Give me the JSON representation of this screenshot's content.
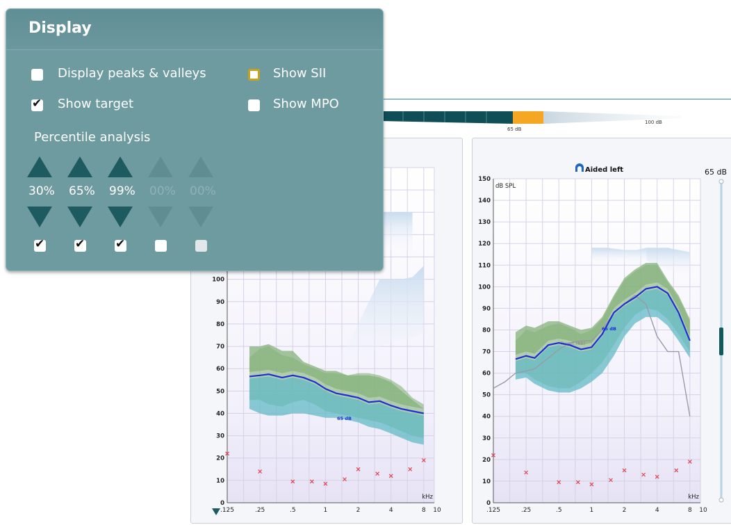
{
  "display_panel": {
    "title": "Display",
    "options": {
      "peaks_valleys": {
        "label": "Display peaks & valleys",
        "checked": false
      },
      "show_sii": {
        "label": "Show SII",
        "checked": false
      },
      "show_target": {
        "label": "Show target",
        "checked": true
      },
      "show_mpo": {
        "label": "Show MPO",
        "checked": false
      }
    },
    "percentile": {
      "label": "Percentile analysis",
      "values": [
        "30%",
        "65%",
        "99%",
        "00%",
        "00%"
      ],
      "checked": [
        true,
        true,
        true,
        false,
        false
      ]
    }
  },
  "level_bar": {
    "marker_65": "65 dB",
    "marker_100": "100 dB"
  },
  "chart_common": {
    "unit": "dB SPL",
    "y_ticks": [
      "0",
      "10",
      "20",
      "30",
      "40",
      "50",
      "60",
      "70",
      "80",
      "90",
      "100",
      "110",
      "120",
      "130",
      "140",
      "150"
    ],
    "x_ticks": [
      ".125",
      ".25",
      ".5",
      "1",
      "2",
      "4",
      "8",
      "10"
    ],
    "x_unit": "kHz",
    "curve_label": "65 dB",
    "target_label": "Target (65)"
  },
  "right_chart": {
    "title": "Aided left",
    "level_readout": "65 dB"
  },
  "chart_data": [
    {
      "type": "line",
      "title": "",
      "ylabel": "dB SPL",
      "xlabel": "kHz",
      "ylim": [
        0,
        150
      ],
      "x_scale": "log",
      "series": [
        {
          "name": "65 dB",
          "x": [
            0.2,
            0.25,
            0.3,
            0.4,
            0.5,
            0.63,
            0.8,
            1,
            1.25,
            1.6,
            2,
            2.5,
            3.15,
            4,
            5,
            6.3,
            8
          ],
          "y": [
            56.5,
            57,
            57.5,
            56,
            57,
            56,
            54,
            51,
            49,
            48,
            47,
            45,
            45.5,
            43.5,
            42,
            41,
            40
          ]
        }
      ],
      "band_65_upper": [
        65,
        69,
        70,
        66,
        65,
        62,
        60,
        58,
        58,
        57,
        58,
        58,
        57,
        55,
        52,
        47,
        44
      ],
      "band_65_lower": [
        42,
        40,
        39,
        39,
        40,
        40,
        39,
        38,
        38,
        37,
        36,
        34,
        33,
        31,
        29,
        27,
        26
      ],
      "band_30_lower": [
        46,
        46,
        44,
        43,
        45,
        46,
        44,
        41,
        40,
        39,
        38,
        37,
        36,
        34,
        32,
        30,
        29
      ],
      "band_99_upper": [
        70,
        70,
        71,
        68,
        68,
        63,
        61,
        59,
        59,
        57,
        57,
        57,
        56,
        54,
        50,
        46,
        42
      ],
      "mpo_fragment": {
        "x": [
          1.0,
          1.6,
          2,
          3.15,
          4,
          5,
          6.3,
          8
        ],
        "y_upper": [
          60,
          70,
          80,
          100,
          100,
          100,
          101,
          106
        ],
        "y_lower": [
          53,
          58,
          62,
          70,
          72,
          73,
          74,
          76
        ]
      },
      "threshold_x": [
        0.125,
        0.25,
        0.5,
        0.75,
        1,
        1.5,
        2,
        3,
        4,
        6,
        8
      ],
      "threshold_y": [
        22,
        14,
        9.5,
        9.5,
        8.5,
        10.5,
        15,
        13,
        12,
        15,
        19
      ]
    },
    {
      "type": "line",
      "title": "Aided left",
      "ylabel": "dB SPL",
      "xlabel": "kHz",
      "ylim": [
        0,
        150
      ],
      "x_scale": "log",
      "series": [
        {
          "name": "65 dB",
          "x": [
            0.2,
            0.25,
            0.3,
            0.4,
            0.5,
            0.63,
            0.8,
            1,
            1.25,
            1.6,
            2,
            2.5,
            3.15,
            4,
            5,
            6.3,
            8
          ],
          "y": [
            66.5,
            68,
            67,
            73,
            74,
            73,
            71,
            72,
            78,
            88,
            92,
            95,
            99,
            100,
            97,
            88,
            75
          ]
        },
        {
          "name": "Target (65)",
          "x": [
            0.125,
            0.16,
            0.2,
            0.25,
            0.3,
            0.4,
            0.5,
            0.63,
            0.8,
            1,
            1.25,
            1.6,
            2,
            2.5,
            3.15,
            4,
            5,
            6.3,
            8
          ],
          "y": [
            53,
            56,
            60,
            61,
            62,
            67,
            71,
            74,
            75,
            75,
            80,
            88,
            92,
            96,
            92,
            77,
            70,
            70,
            40
          ]
        }
      ],
      "band_65_upper": [
        75,
        80,
        79,
        82,
        83,
        81,
        78,
        80,
        85,
        95,
        103,
        107,
        110,
        110,
        102,
        95,
        84
      ],
      "band_65_lower": [
        57,
        58,
        55,
        52,
        51,
        51,
        53,
        56,
        60,
        68,
        77,
        83,
        86,
        86,
        82,
        75,
        67
      ],
      "band_99_upper": [
        79,
        82,
        81,
        84,
        84,
        82,
        80,
        81,
        86,
        96,
        104,
        108,
        111,
        111,
        103,
        96,
        85
      ],
      "band_30_lower": [
        60,
        60,
        57,
        54,
        53,
        53,
        56,
        60,
        65,
        73,
        81,
        87,
        90,
        89,
        85,
        78,
        70
      ],
      "threshold_x": [
        0.125,
        0.25,
        0.5,
        0.75,
        1,
        1.5,
        2,
        3,
        4,
        6,
        8
      ],
      "threshold_y": [
        22,
        14,
        9.5,
        9.5,
        8.5,
        10.5,
        15,
        13,
        12,
        15,
        19
      ]
    }
  ],
  "colors": {
    "panel_bg": "#6e9ba0",
    "arrow": "#1d5b60",
    "level_dark": "#0f4e57",
    "level_orange": "#f5a623",
    "curve": "#1a2fd6",
    "band_green": "#86b27c",
    "band_teal": "#62b9c6",
    "threshold": "#e04455",
    "mpo": "#c9dcef"
  }
}
